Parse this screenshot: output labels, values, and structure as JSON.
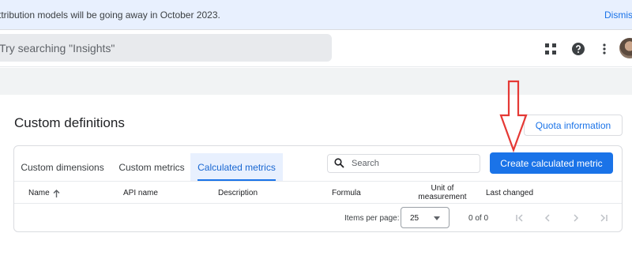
{
  "banner": {
    "message": "ttribution models will be going away in October 2023.",
    "dismiss_label": "Dismiss"
  },
  "topbar": {
    "search_placeholder": "Try searching \"Insights\"",
    "icons": [
      "apps-grid-icon",
      "help-icon",
      "more-vert-icon",
      "avatar"
    ]
  },
  "page": {
    "title": "Custom definitions",
    "quota_button": "Quota information"
  },
  "tabs": [
    {
      "label": "Custom dimensions",
      "active": false
    },
    {
      "label": "Custom metrics",
      "active": false
    },
    {
      "label": "Calculated metrics",
      "active": true
    }
  ],
  "card": {
    "search_placeholder": "Search",
    "create_button": "Create calculated metric"
  },
  "table": {
    "columns": [
      "Name",
      "API name",
      "Description",
      "Formula",
      "Unit of measurement",
      "Last changed"
    ],
    "rows": []
  },
  "pagination": {
    "items_per_page_label": "Items per page:",
    "items_per_page": "25",
    "range": "0 of 0"
  },
  "colors": {
    "accent": "#1a73e8",
    "banner_bg": "#e8f0fe",
    "annotation_arrow": "#e53935"
  }
}
